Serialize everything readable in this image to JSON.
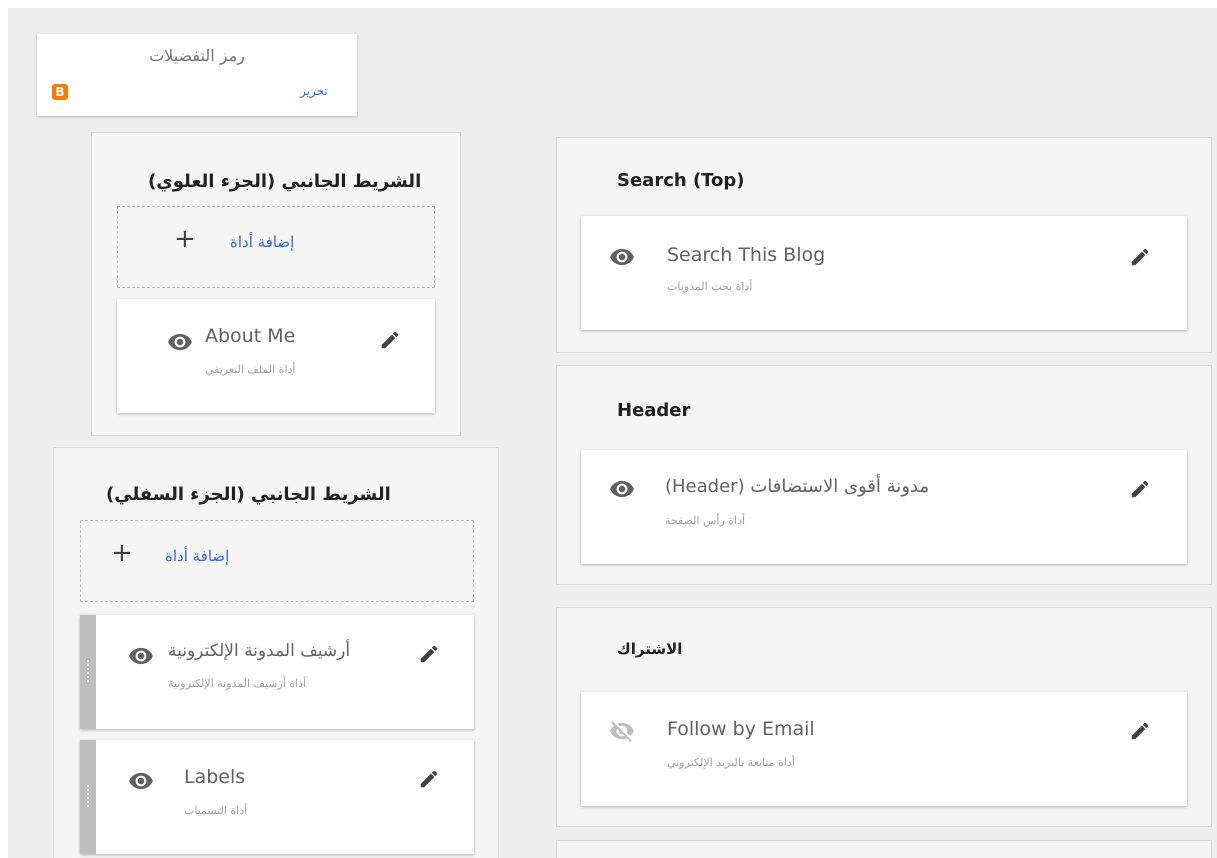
{
  "favicon": {
    "title": "رمز التفضيلات",
    "edit_label": "تحرير",
    "logo_letter": "B",
    "logo_color": "#f57d00"
  },
  "sidebar_top": {
    "title": "(الشريط الجانبي (الجزء العلوي",
    "add_label": "إضافة أداة",
    "widgets": [
      {
        "name": "About Me",
        "subtitle": "أداة الملف التعريفي",
        "icon": "eye-icon"
      }
    ]
  },
  "sidebar_bottom": {
    "title": "(الشريط الجانبي (الجزء السفلي",
    "add_label": "إضافة أداة",
    "widgets": [
      {
        "name": "أرشيف المدونة الإلكترونية",
        "subtitle": "أداة أرشيف المدونة الإلكترونية",
        "icon": "eye-icon"
      },
      {
        "name": "Labels",
        "subtitle": "أداة التسميات",
        "icon": "eye-icon"
      }
    ]
  },
  "search_section": {
    "title": "Search (Top)",
    "widget": {
      "name": "Search This Blog",
      "subtitle": "أداة بحث المدونات",
      "icon": "eye-icon"
    }
  },
  "header_section": {
    "title": "Header",
    "widget": {
      "name": "(Header) مدونة أقوى الاستضافات",
      "subtitle": "أداة رأس الصفحة",
      "icon": "eye-icon"
    }
  },
  "subscribe_section": {
    "title": "الاشتراك",
    "widget": {
      "name": "Follow by Email",
      "subtitle": "أداة متابعة بالبريد الإلكتروني",
      "icon": "eye-off-icon"
    }
  },
  "colors": {
    "accent": "#3367d6",
    "panel": "#f5f5f5",
    "icon": "#616161"
  }
}
